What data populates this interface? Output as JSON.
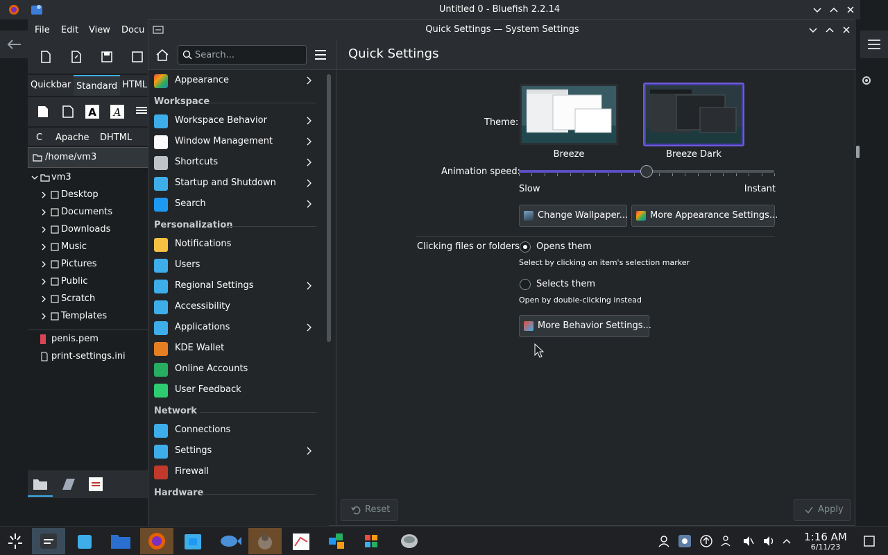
{
  "background_window": {
    "title": "Untitled 0 - Bluefish 2.2.14",
    "menu": [
      "File",
      "Edit",
      "View",
      "Docu"
    ],
    "tabs": [
      "Quickbar",
      "Standard",
      "HTML"
    ],
    "html_tabs": [
      "C",
      "Apache",
      "DHTML"
    ],
    "path": "/home/vm3",
    "tree": {
      "root": "vm3",
      "folders": [
        "Desktop",
        "Documents",
        "Downloads",
        "Music",
        "Pictures",
        "Public",
        "Scratch",
        "Templates"
      ],
      "files": [
        "penis.pem",
        "print-settings.ini"
      ]
    }
  },
  "settings_window": {
    "title": "Quick Settings — System Settings",
    "search_placeholder": "Search...",
    "page_title": "Quick Settings",
    "sidebar": {
      "top_item": "Appearance",
      "sections": [
        {
          "title": "Workspace",
          "items": [
            {
              "label": "Workspace Behavior",
              "arrow": true
            },
            {
              "label": "Window Management",
              "arrow": true
            },
            {
              "label": "Shortcuts",
              "arrow": true
            },
            {
              "label": "Startup and Shutdown",
              "arrow": true
            },
            {
              "label": "Search",
              "arrow": true
            }
          ]
        },
        {
          "title": "Personalization",
          "items": [
            {
              "label": "Notifications",
              "arrow": false
            },
            {
              "label": "Users",
              "arrow": false
            },
            {
              "label": "Regional Settings",
              "arrow": true
            },
            {
              "label": "Accessibility",
              "arrow": false
            },
            {
              "label": "Applications",
              "arrow": true
            },
            {
              "label": "KDE Wallet",
              "arrow": false
            },
            {
              "label": "Online Accounts",
              "arrow": false
            },
            {
              "label": "User Feedback",
              "arrow": false
            }
          ]
        },
        {
          "title": "Network",
          "items": [
            {
              "label": "Connections",
              "arrow": false
            },
            {
              "label": "Settings",
              "arrow": true
            },
            {
              "label": "Firewall",
              "arrow": false
            }
          ]
        },
        {
          "title": "Hardware",
          "items": []
        }
      ]
    },
    "content": {
      "theme_label": "Theme:",
      "themes": [
        {
          "name": "Breeze",
          "selected": false
        },
        {
          "name": "Breeze Dark",
          "selected": true
        }
      ],
      "animation_label": "Animation speed:",
      "animation_value": 0.5,
      "slow_label": "Slow",
      "instant_label": "Instant",
      "change_wallpaper": "Change Wallpaper...",
      "more_appearance": "More Appearance Settings...",
      "click_label": "Clicking files or folders:",
      "opens_them": "Opens them",
      "opens_hint": "Select by clicking on item's selection marker",
      "selects_them": "Selects them",
      "selects_hint": "Open by double-clicking instead",
      "more_behavior": "More Behavior Settings...",
      "click_choice": "opens"
    },
    "reset": "Reset",
    "apply": "Apply"
  },
  "taskbar": {
    "time": "1:16 AM",
    "date": "6/11/23"
  },
  "colors": {
    "accent": "#3daee9",
    "selected_theme_border": "#6e5bd6",
    "slider_fill": "#5b4ec2"
  }
}
